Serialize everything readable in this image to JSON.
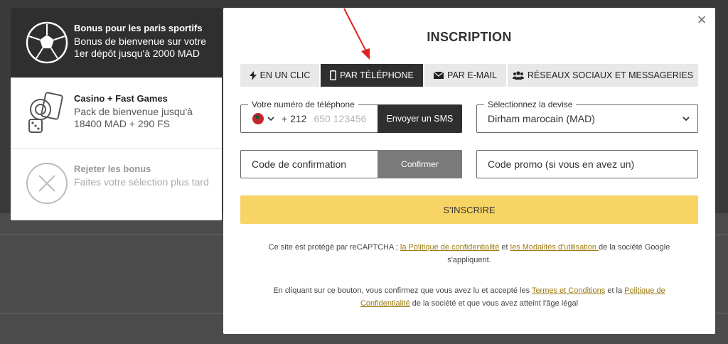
{
  "bonus": {
    "items": [
      {
        "title": "Bonus pour les paris sportifs",
        "desc": "Bonus de bienvenue sur votre 1er dépôt jusqu'à 2000 MAD",
        "icon": "soccer-ball-icon"
      },
      {
        "title": "Casino + Fast Games",
        "desc": "Pack de bienvenue jusqu'à 18400 MAD + 290 FS",
        "icon": "casino-chips-icon"
      },
      {
        "title": "Rejeter les bonus",
        "desc": "Faites votre sélection plus tard",
        "icon": "reject-x-icon"
      }
    ]
  },
  "modal": {
    "title": "INSCRIPTION",
    "close": "×",
    "tabs": [
      {
        "label": "EN UN CLIC",
        "icon": "lightning-icon"
      },
      {
        "label": "PAR TÉLÉPHONE",
        "icon": "phone-icon"
      },
      {
        "label": "PAR E-MAIL",
        "icon": "envelope-icon"
      },
      {
        "label": "RÉSEAUX SOCIAUX ET MESSAGERIES",
        "icon": "users-icon"
      }
    ],
    "phone": {
      "label": "Votre numéro de téléphone",
      "prefix": "+ 212",
      "placeholder": "650 123456",
      "sms_button": "Envoyer un SMS"
    },
    "currency": {
      "label": "Sélectionnez la devise",
      "value": "Dirham marocain (MAD)"
    },
    "confirmation": {
      "placeholder": "Code de confirmation",
      "button": "Confirmer"
    },
    "promo": {
      "placeholder": "Code promo (si vous en avez un)"
    },
    "submit": "S'INSCRIRE",
    "legal1": {
      "pre": "Ce site est protégé par reCAPTCHA ; ",
      "link1": "la Politique de confidentialité",
      "mid": " et ",
      "link2": "les Modalités d'utilisation ",
      "post": "de la société Google s'appliquent."
    },
    "legal2": {
      "pre": "En cliquant sur ce bouton, vous confirmez que vous avez lu et accepté les ",
      "link1": "Termes et Conditions",
      "mid": " et la ",
      "link2": "Politique de Confidentialité",
      "post": " de la société et que vous avez atteint l'âge légal"
    }
  },
  "colors": {
    "accent": "#f7d463",
    "dark": "#2f2f2f",
    "link": "#9a7a10"
  }
}
